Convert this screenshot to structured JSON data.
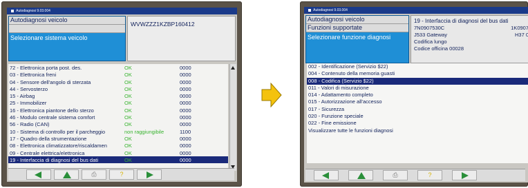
{
  "left_screen": {
    "window_title": "Autodiagnosi 9.03.004",
    "info": {
      "row1": "Autodiagnosi veicolo",
      "row2": "",
      "selected_label": "Selezionare sistema veicolo",
      "vin": "WVWZZZ1KZBP160412"
    },
    "columns": [
      "name",
      "status",
      "code"
    ],
    "items": [
      {
        "name": "72 - Elettronica porta post. des.",
        "status": "OK",
        "code": "0000"
      },
      {
        "name": "03 - Elettronica freni",
        "status": "OK",
        "code": "0000"
      },
      {
        "name": "04 - Sensore dell'angolo di sterzata",
        "status": "OK",
        "code": "0000"
      },
      {
        "name": "44 - Servosterzo",
        "status": "OK",
        "code": "0000"
      },
      {
        "name": "15 - Airbag",
        "status": "OK",
        "code": "0000"
      },
      {
        "name": "25 - Immobilizer",
        "status": "OK",
        "code": "0000"
      },
      {
        "name": "16 - Elettronica piantone dello sterzo",
        "status": "OK",
        "code": "0000"
      },
      {
        "name": "46 - Modulo centrale sistema comfort",
        "status": "OK",
        "code": "0000"
      },
      {
        "name": "56 - Radio (CAN)",
        "status": "OK",
        "code": "0000"
      },
      {
        "name": "10 - Sistema di controllo per il parcheggio",
        "status": "non raggiungibile",
        "code": "1100"
      },
      {
        "name": "17 - Quadro della strumentazione",
        "status": "OK",
        "code": "0000"
      },
      {
        "name": "08 - Elettronica climatizzatore/riscaldamen",
        "status": "OK",
        "code": "0000"
      },
      {
        "name": "09 - Centrale elettrica/elettronica",
        "status": "OK",
        "code": "0000"
      },
      {
        "name": "19 - Interfaccia di diagnosi del bus dati",
        "status": "OK",
        "code": "0000",
        "selected": true
      }
    ]
  },
  "right_screen": {
    "window_title": "Autodiagnosi 9.03.004",
    "info": {
      "row1": "Autodiagnosi veicolo",
      "row2": "Funzioni supportate",
      "selected_label": "Selezionare funzione diagnosi",
      "lines": [
        "19 - Interfaccia di diagnosi del bus dati",
        "7N0907530C",
        "J533  Gateway",
        "Codifica lungo",
        "Codice officina 00028"
      ],
      "part_right": "1K0907",
      "h37": "H37  0"
    },
    "functions": [
      {
        "label": "002 - Identificazione (Servizio $22)"
      },
      {
        "label": "004 - Contenuto della memoria guasti"
      },
      {
        "label": "008 - Codifica (Servizio $22)",
        "selected": true
      },
      {
        "label": "011 - Valori di misurazione"
      },
      {
        "label": "014 - Adattamento completo"
      },
      {
        "label": "015 - Autorizzazione all'accesso"
      },
      {
        "label": "017 - Sicurezza"
      },
      {
        "label": "020 - Funzione speciale"
      },
      {
        "label": "022 - Fine emissione"
      },
      {
        "label": "Visualizzare tutte le funzioni diagnosi"
      }
    ]
  },
  "toolbar_icons": [
    "back-arrow-icon",
    "up-arrow-icon",
    "print-icon",
    "help-icon",
    "forward-arrow-icon"
  ],
  "colors": {
    "selection": "#1a2a7a",
    "info_blue": "#1f8fd6",
    "ok_green": "#37b32e",
    "arrow_yellow": "#f4c20d",
    "nav_green": "#2a8f3a"
  }
}
